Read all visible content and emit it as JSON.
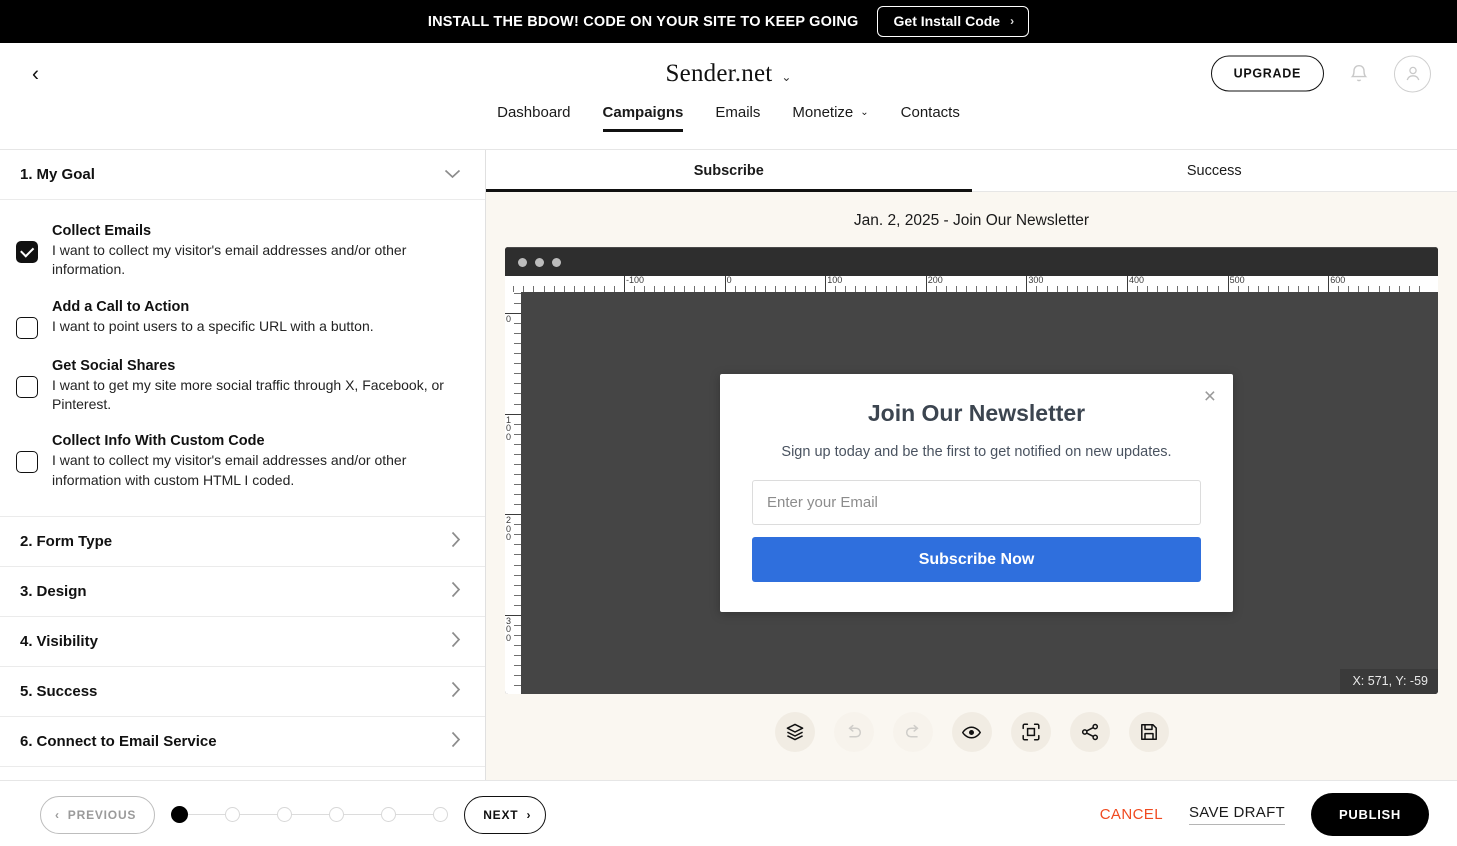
{
  "promo": {
    "text": "INSTALL THE BDOW! CODE ON YOUR SITE TO KEEP GOING",
    "button_label": "Get Install Code",
    "chevron": "›"
  },
  "header": {
    "back_icon": "‹",
    "brand": "Sender.net",
    "brand_caret": "⌄",
    "upgrade_label": "UPGRADE",
    "bell_icon": "bell-icon",
    "avatar_icon": "user-avatar-icon"
  },
  "nav": {
    "items": [
      {
        "label": "Dashboard",
        "active": false,
        "caret": ""
      },
      {
        "label": "Campaigns",
        "active": true,
        "caret": ""
      },
      {
        "label": "Emails",
        "active": false,
        "caret": ""
      },
      {
        "label": "Monetize",
        "active": false,
        "caret": "⌄"
      },
      {
        "label": "Contacts",
        "active": false,
        "caret": ""
      }
    ]
  },
  "sidebar": {
    "goal_section": {
      "number": "1.",
      "title": "My Goal",
      "chevron": "⌄",
      "options": [
        {
          "title": "Collect Emails",
          "desc": "I want to collect my visitor's email addresses and/or other information.",
          "checked": true
        },
        {
          "title": "Add a Call to Action",
          "desc": "I want to point users to a specific URL with a button.",
          "checked": false
        },
        {
          "title": "Get Social Shares",
          "desc": "I want to get my site more social traffic through X, Facebook, or Pinterest.",
          "checked": false
        },
        {
          "title": "Collect Info With Custom Code",
          "desc": "I want to collect my visitor's email addresses and/or other information with custom HTML I coded.",
          "checked": false
        }
      ]
    },
    "rows": [
      {
        "number": "2.",
        "title": "Form Type",
        "chevron": "›"
      },
      {
        "number": "3.",
        "title": "Design",
        "chevron": "›"
      },
      {
        "number": "4.",
        "title": "Visibility",
        "chevron": "›"
      },
      {
        "number": "5.",
        "title": "Success",
        "chevron": "›"
      },
      {
        "number": "6.",
        "title": "Connect to Email Service",
        "chevron": "›"
      }
    ]
  },
  "preview": {
    "tabs": [
      {
        "label": "Subscribe",
        "active": true
      },
      {
        "label": "Success",
        "active": false
      }
    ],
    "title": "Jan. 2, 2025 - Join Our Newsletter",
    "coordinates": "X: 571, Y: -59",
    "ruler_h_labels": [
      "-100",
      "0",
      "100",
      "200",
      "300",
      "400",
      "500",
      "600"
    ],
    "ruler_v_labels": [
      "0",
      "100",
      "200",
      "300"
    ],
    "popup": {
      "close_icon": "×",
      "title": "Join Our Newsletter",
      "subtitle": "Sign up today and be the first to get notified on new updates.",
      "email_placeholder": "Enter your Email",
      "email_value": "",
      "button_label": "Subscribe Now",
      "button_color": "#2f6fdd"
    },
    "tools": [
      {
        "name": "layers-icon",
        "disabled": false
      },
      {
        "name": "undo-icon",
        "disabled": true
      },
      {
        "name": "redo-icon",
        "disabled": true
      },
      {
        "name": "eye-preview-icon",
        "disabled": false
      },
      {
        "name": "fit-to-screen-icon",
        "disabled": false
      },
      {
        "name": "share-icon",
        "disabled": false
      },
      {
        "name": "save-icon",
        "disabled": false
      }
    ]
  },
  "footer": {
    "previous_label": "PREVIOUS",
    "previous_chevron": "‹",
    "next_label": "NEXT",
    "next_chevron": "›",
    "steps_total": 6,
    "steps_current": 1,
    "cancel_label": "CANCEL",
    "save_draft_label": "SAVE DRAFT",
    "publish_label": "PUBLISH"
  },
  "colors": {
    "accent_black": "#000000",
    "cancel_orange": "#f04a20",
    "cta_blue": "#2f6fdd",
    "canvas_bg": "#faf7f1",
    "stage_gray": "#454545"
  }
}
